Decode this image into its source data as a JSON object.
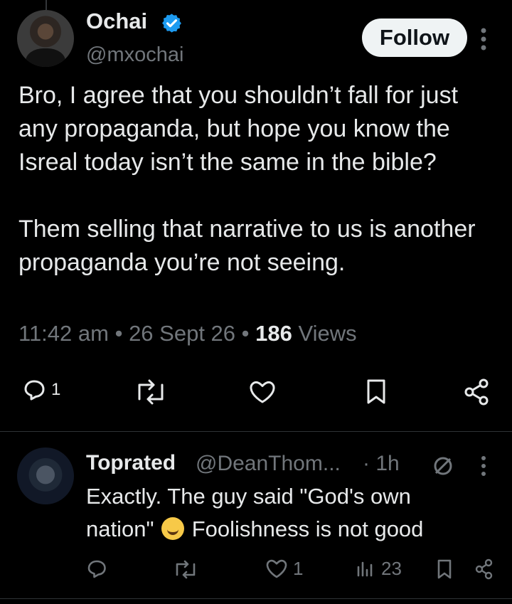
{
  "main_tweet": {
    "display_name": "Ochai",
    "handle": "@mxochai",
    "follow_label": "Follow",
    "text": "Bro, I agree that you shouldn’t fall for just any propaganda, but hope you know the Isreal today isn’t the same in the bible?\n\nThem selling that narrative to us is another propaganda you’re not seeing.",
    "time": "11:42 am",
    "date": "26 Sept 26",
    "separator": "•",
    "views_count": "186",
    "views_label": "Views",
    "reply_count": "1"
  },
  "reply": {
    "display_name": "Toprated",
    "handle": "@DeanThom...",
    "time": "· 1h",
    "text_line1": "Exactly. The guy said \"God's own",
    "text_line2_before": "nation\"",
    "text_line2_after": "Foolishness is not good",
    "like_count": "1",
    "views_count": "23"
  },
  "colors": {
    "background": "#000000",
    "primary_text": "#e7e9ea",
    "secondary_text": "#71767b",
    "verified_blue": "#1d9bf0",
    "follow_button_bg": "#eff3f4"
  }
}
